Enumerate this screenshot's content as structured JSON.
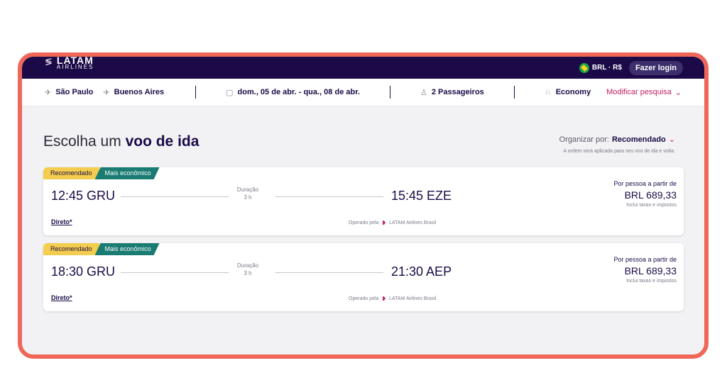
{
  "header": {
    "logo_brand": "LATAM",
    "logo_sub": "AIRLINES",
    "currency": "BRL · R$",
    "login_label": "Fazer login"
  },
  "search": {
    "origin": "São Paulo",
    "destination": "Buenos Aires",
    "dates": "dom., 05 de abr. - qua., 08 de abr.",
    "passengers": "2 Passageiros",
    "cabin": "Economy",
    "modify_label": "Modificar pesquisa"
  },
  "main": {
    "title_prefix": "Escolha um",
    "title_bold": "voo de ida",
    "sort_label": "Organizar por:",
    "sort_value": "Recomendado",
    "sort_note": "A ordem será aplicada para seu voo de ida e volta."
  },
  "flights": [
    {
      "badge_recommended": "Recomendado",
      "badge_cheapest": "Mais econômico",
      "departure": "12:45 GRU",
      "duration_label": "Duração",
      "duration": "3 h",
      "arrival": "15:45 EZE",
      "price_label": "Por pessoa a partir de",
      "price": "BRL 689,33",
      "price_note": "Inclui taxas e impostos",
      "stops": "Direto*",
      "operated_label": "Operado pela",
      "operator": "LATAM Airlines Brasil"
    },
    {
      "badge_recommended": "Recomendado",
      "badge_cheapest": "Mais econômico",
      "departure": "18:30 GRU",
      "duration_label": "Duração",
      "duration": "3 h",
      "arrival": "21:30 AEP",
      "price_label": "Por pessoa a partir de",
      "price": "BRL 689,33",
      "price_note": "Inclui taxas e impostos",
      "stops": "Direto*",
      "operated_label": "Operado pela",
      "operator": "LATAM Airlines Brasil"
    }
  ],
  "colors": {
    "frame": "#f0675a",
    "navy": "#1b0a47",
    "magenta": "#c11d5f",
    "badge_yellow": "#f4cd4e",
    "badge_teal": "#1a7b72"
  }
}
